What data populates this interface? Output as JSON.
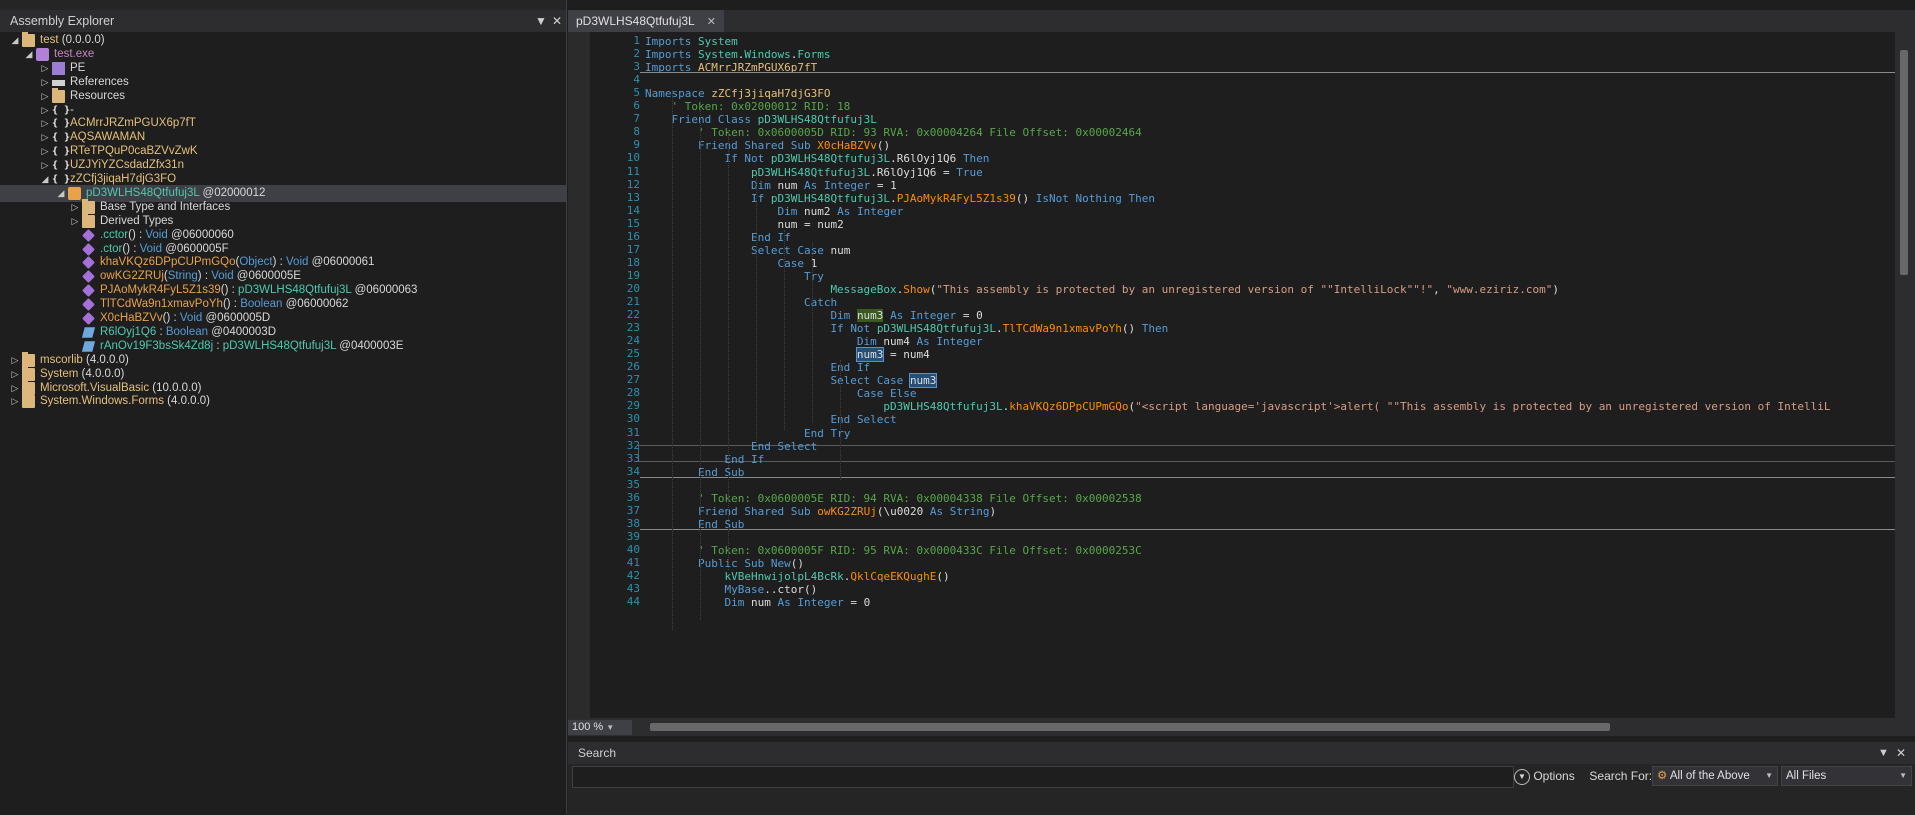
{
  "assembly_explorer": {
    "title": "Assembly Explorer",
    "tree": [
      {
        "label": "test",
        "suffix": " (0.0.0.0)",
        "icon": "assembly-icon"
      },
      {
        "label": "test.exe",
        "icon": "module-icon"
      },
      {
        "label": "PE",
        "icon": "pe-icon"
      },
      {
        "label": "References",
        "icon": "references-icon"
      },
      {
        "label": "Resources",
        "icon": "folder-icon"
      },
      {
        "label": "-",
        "icon": "namespace-icon"
      },
      {
        "label": "ACMrrJRZmPGUX6p7fT",
        "icon": "namespace-icon"
      },
      {
        "label": "AQSAWAMAN",
        "icon": "namespace-icon"
      },
      {
        "label": "RTeTPQuP0caBZVvZwK",
        "icon": "namespace-icon"
      },
      {
        "label": "UZJYiYZCsdadZfx31n",
        "icon": "namespace-icon"
      },
      {
        "label": "zZCfj3jiqaH7djG3FO",
        "icon": "namespace-icon"
      },
      {
        "label": "pD3WLHS48Qtfufuj3L",
        "suffix": " @02000012",
        "icon": "class-icon"
      },
      {
        "label": "Base Type and Interfaces",
        "icon": "folder-icon"
      },
      {
        "label": "Derived Types",
        "icon": "folder-icon"
      },
      {
        "label": ".cctor",
        "sig": "() : ",
        "type": "Void",
        "suffix": " @06000060",
        "icon": "method-icon"
      },
      {
        "label": ".ctor",
        "sig": "() : ",
        "type": "Void",
        "suffix": " @0600005F",
        "icon": "method-icon"
      },
      {
        "label": "khaVKQz6DPpCUPmGQo",
        "sig": "(",
        "param": "Object",
        "sig2": ") : ",
        "type": "Void",
        "suffix": " @06000061",
        "icon": "method-icon"
      },
      {
        "label": "owKG2ZRUj",
        "sig": "(",
        "param": "String",
        "sig2": ") : ",
        "type": "Void",
        "suffix": " @0600005E",
        "icon": "method-icon"
      },
      {
        "label": "PJAoMykR4FyL5Z1s39",
        "sig": "() : ",
        "type": "pD3WLHS48Qtfufuj3L",
        "suffix": " @06000063",
        "icon": "method-icon"
      },
      {
        "label": "TlTCdWa9n1xmavPoYh",
        "sig": "() : ",
        "type": "Boolean",
        "suffix": " @06000062",
        "icon": "method-icon"
      },
      {
        "label": "X0cHaBZVv",
        "sig": "() : ",
        "type": "Void",
        "suffix": " @0600005D",
        "icon": "method-icon"
      },
      {
        "label": "R6lOyj1Q6",
        "sig": " : ",
        "type": "Boolean",
        "suffix": " @0400003D",
        "icon": "field-icon"
      },
      {
        "label": "rAnOv19F3bsSk4Zd8j",
        "sig": " : ",
        "type": "pD3WLHS48Qtfufuj3L",
        "suffix": " @0400003E",
        "icon": "field-icon"
      },
      {
        "label": "mscorlib",
        "suffix": " (4.0.0.0)",
        "icon": "assembly-icon"
      },
      {
        "label": "System",
        "suffix": " (4.0.0.0)",
        "icon": "assembly-icon"
      },
      {
        "label": "Microsoft.VisualBasic",
        "suffix": " (10.0.0.0)",
        "icon": "assembly-icon"
      },
      {
        "label": "System.Windows.Forms",
        "suffix": " (4.0.0.0)",
        "icon": "assembly-icon"
      }
    ]
  },
  "editor": {
    "tab_label": "pD3WLHS48Qtfufuj3L",
    "zoom": "100 %",
    "lines": [
      "Imports System",
      "Imports System.Windows.Forms",
      "Imports ACMrrJRZmPGUX6p7fT",
      "",
      "Namespace zZCfj3jiqaH7djG3FO",
      "    ' Token: 0x02000012 RID: 18",
      "    Friend Class pD3WLHS48Qtfufuj3L",
      "        ' Token: 0x0600005D RID: 93 RVA: 0x00004264 File Offset: 0x00002464",
      "        Friend Shared Sub X0cHaBZVv()",
      "            If Not pD3WLHS48Qtfufuj3L.R6lOyj1Q6 Then",
      "                pD3WLHS48Qtfufuj3L.R6lOyj1Q6 = True",
      "                Dim num As Integer = 1",
      "                If pD3WLHS48Qtfufuj3L.PJAoMykR4FyL5Z1s39() IsNot Nothing Then",
      "                    Dim num2 As Integer",
      "                    num = num2",
      "                End If",
      "                Select Case num",
      "                    Case 1",
      "                        Try",
      "                            MessageBox.Show(\"This assembly is protected by an unregistered version of \"\"IntelliLock\"\"!\", \"www.eziriz.com\")",
      "                        Catch",
      "                            Dim num3 As Integer = 0",
      "                            If Not pD3WLHS48Qtfufuj3L.TlTCdWa9n1xmavPoYh() Then",
      "                                Dim num4 As Integer",
      "                                num3 = num4",
      "                            End If",
      "                            Select Case num3",
      "                                Case Else",
      "                                    pD3WLHS48Qtfufuj3L.khaVKQz6DPpCUPmGQo(\"<script language='javascript'>alert( \"\"This assembly is protected by an unregistered version of IntelliL",
      "                            End Select",
      "                        End Try",
      "                End Select",
      "            End If",
      "        End Sub",
      "",
      "        ' Token: 0x0600005E RID: 94 RVA: 0x00004338 File Offset: 0x00002538",
      "        Friend Shared Sub owKG2ZRUj(\\u0020 As String)",
      "        End Sub",
      "",
      "        ' Token: 0x0600005F RID: 95 RVA: 0x0000433C File Offset: 0x0000253C",
      "        Public Sub New()",
      "            kVBeHnwijolpL4BcRk.QklCqeEKQughE()",
      "            MyBase..ctor()",
      "            Dim num As Integer = 0"
    ]
  },
  "search_panel": {
    "title": "Search",
    "options_label": "Options",
    "search_for_label": "Search For:",
    "search_for_value": "All of the Above",
    "scope_value": "All Files"
  },
  "colors": {
    "background": "#1e1e1e",
    "keyword": "#569cd6",
    "type": "#4ec9b0",
    "method": "#ff8c00",
    "comment": "#57a64a",
    "string": "#d69d85",
    "line_number": "#2b91af"
  }
}
